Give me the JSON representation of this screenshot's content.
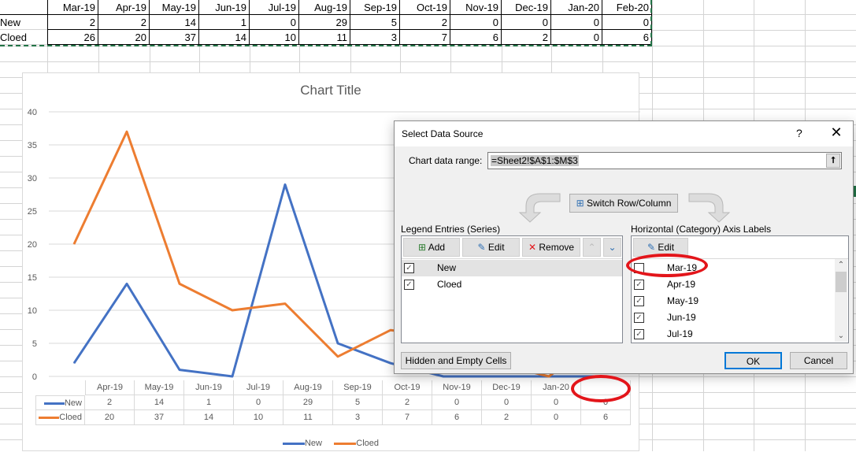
{
  "sheet": {
    "row_labels": [
      "New",
      "Cloed"
    ],
    "months": [
      "Mar-19",
      "Apr-19",
      "May-19",
      "Jun-19",
      "Jul-19",
      "Aug-19",
      "Sep-19",
      "Oct-19",
      "Nov-19",
      "Dec-19",
      "Jan-20",
      "Feb-20"
    ],
    "new": [
      "2",
      "2",
      "14",
      "1",
      "0",
      "29",
      "5",
      "2",
      "0",
      "0",
      "0",
      "0"
    ],
    "cloed": [
      "26",
      "20",
      "37",
      "14",
      "10",
      "11",
      "3",
      "7",
      "6",
      "2",
      "0",
      "6"
    ]
  },
  "chart": {
    "title": "Chart Title",
    "y_ticks": [
      "0",
      "5",
      "10",
      "15",
      "20",
      "25",
      "30",
      "35",
      "40"
    ],
    "table_categories": [
      "Apr-19",
      "May-19",
      "Jun-19",
      "Jul-19",
      "Aug-19",
      "Sep-19",
      "Oct-19",
      "Nov-19",
      "Dec-19",
      "Jan-20",
      ""
    ],
    "series_labels": [
      "New",
      "Cloed"
    ],
    "table_new": [
      "2",
      "14",
      "1",
      "0",
      "29",
      "5",
      "2",
      "0",
      "0",
      "0",
      "0"
    ],
    "table_cloed": [
      "20",
      "37",
      "14",
      "10",
      "11",
      "3",
      "7",
      "6",
      "2",
      "0",
      "6"
    ],
    "legend": [
      "New",
      "Cloed"
    ],
    "colors": {
      "new": "#4472c4",
      "cloed": "#ed7d31"
    }
  },
  "chart_data": {
    "type": "line",
    "title": "Chart Title",
    "xlabel": "",
    "ylabel": "",
    "ylim": [
      0,
      40
    ],
    "grid": true,
    "legend": "bottom",
    "categories": [
      "Apr-19",
      "May-19",
      "Jun-19",
      "Jul-19",
      "Aug-19",
      "Sep-19",
      "Oct-19",
      "Nov-19",
      "Dec-19",
      "Jan-20",
      ""
    ],
    "series": [
      {
        "name": "New",
        "values": [
          2,
          14,
          1,
          0,
          29,
          5,
          2,
          0,
          0,
          0,
          0
        ]
      },
      {
        "name": "Cloed",
        "values": [
          20,
          37,
          14,
          10,
          11,
          3,
          7,
          6,
          2,
          0,
          6
        ]
      }
    ]
  },
  "dialog": {
    "title": "Select Data Source",
    "help": "?",
    "close": "✕",
    "range_label": "Chart data range:",
    "range_value": "=Sheet2!$A$1:$M$3",
    "switch_label": "Switch Row/Column",
    "legend_section": "Legend Entries (Series)",
    "axis_section": "Horizontal (Category) Axis Labels",
    "add": "Add",
    "edit": "Edit",
    "remove": "Remove",
    "axis_edit": "Edit",
    "series": [
      {
        "label": "New",
        "checked": true,
        "selected": true
      },
      {
        "label": "Cloed",
        "checked": true,
        "selected": false
      }
    ],
    "axis_labels": [
      {
        "label": "Mar-19",
        "checked": false
      },
      {
        "label": "Apr-19",
        "checked": true
      },
      {
        "label": "May-19",
        "checked": true
      },
      {
        "label": "Jun-19",
        "checked": true
      },
      {
        "label": "Jul-19",
        "checked": true
      }
    ],
    "hidden_cells": "Hidden and Empty Cells",
    "ok": "OK",
    "cancel": "Cancel"
  }
}
